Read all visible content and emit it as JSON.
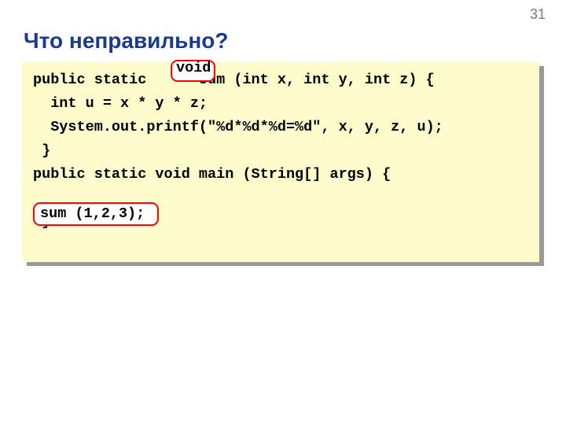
{
  "page_number": "31",
  "title": "Что неправильно?",
  "code": {
    "line1": "public static      sum (int x, int y, int z) {",
    "line2": "  int u = x * y * z;",
    "line3": "  System.out.printf(\"%d*%d*%d=%d\", x, y, z, u);",
    "line4": " }",
    "line5": "public static void main (String[] args) {",
    "line6_blank": "",
    "line7": " }"
  },
  "highlights": {
    "void_label": "void",
    "sum_call": "sum (1,2,3);"
  }
}
